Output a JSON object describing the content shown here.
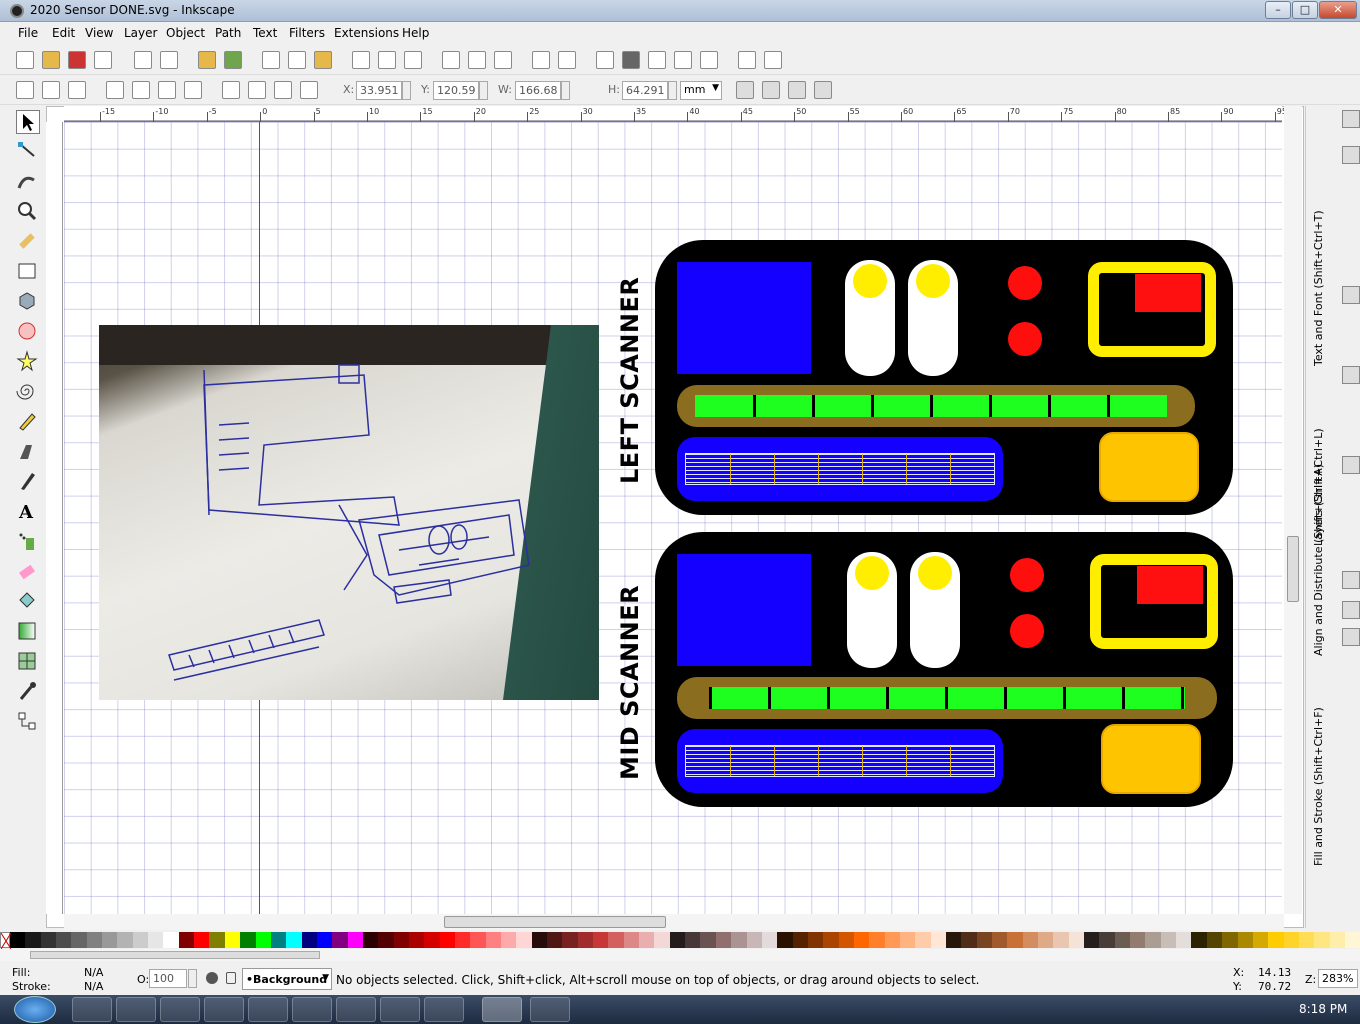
{
  "window": {
    "title": "2020 Sensor DONE.svg - Inkscape",
    "minimize": "–",
    "maximize": "□",
    "close": "✕"
  },
  "menu": [
    "File",
    "Edit",
    "View",
    "Layer",
    "Object",
    "Path",
    "Text",
    "Filters",
    "Extensions",
    "Help"
  ],
  "controls": {
    "x_label": "X:",
    "x_value": "33.951",
    "y_label": "Y:",
    "y_value": "120.590",
    "w_label": "W:",
    "w_value": "166.686",
    "h_label": "H:",
    "h_value": "64.291",
    "unit": "mm"
  },
  "ruler_labels": [
    "-15",
    "-10",
    "-5",
    "0",
    "5",
    "10",
    "15",
    "20",
    "25",
    "30",
    "35",
    "40",
    "45",
    "50",
    "55",
    "60",
    "65",
    "70",
    "75",
    "80",
    "85",
    "90",
    "95",
    "100"
  ],
  "canvas": {
    "scanner_top_label": "LEFT SCANNER",
    "scanner_bottom_label": "MID SCANNER",
    "sketch": {
      "note": "hand sketch photo"
    }
  },
  "docks": {
    "text_font": "Text and Font (Shift+Ctrl+T)",
    "layers": "Layers (Shift+Ctrl+L)",
    "align": "Align and Distribute (Shift+Ctrl+A)",
    "fill_stroke": "Fill and Stroke (Shift+Ctrl+F)"
  },
  "status": {
    "fill_label": "Fill:",
    "fill_value": "N/A",
    "stroke_label": "Stroke:",
    "stroke_value": "N/A",
    "opacity_label": "O:",
    "opacity_value": "100",
    "layer": "•Background",
    "message": "No objects selected. Click, Shift+click, Alt+scroll mouse on top of objects, or drag around objects to select.",
    "x_label": "X:",
    "x_value": "14.13",
    "y_label": "Y:",
    "y_value": "70.72",
    "zoom_label": "Z:",
    "zoom_value": "283%"
  },
  "taskbar": {
    "clock": "8:18 PM"
  },
  "palette": [
    "#000000",
    "#1a1a1a",
    "#333333",
    "#4d4d4d",
    "#666666",
    "#808080",
    "#999999",
    "#b3b3b3",
    "#cccccc",
    "#e6e6e6",
    "#ffffff",
    "#800000",
    "#ff0000",
    "#808000",
    "#ffff00",
    "#008000",
    "#00ff00",
    "#008080",
    "#00ffff",
    "#000080",
    "#0000ff",
    "#800080",
    "#ff00ff",
    "#2b0000",
    "#550000",
    "#800000",
    "#aa0000",
    "#d40000",
    "#ff0000",
    "#ff2a2a",
    "#ff5555",
    "#ff8080",
    "#ffaaaa",
    "#ffd5d5",
    "#280b0b",
    "#501616",
    "#782121",
    "#a02c2c",
    "#c83737",
    "#d35f5f",
    "#de8787",
    "#e9afaf",
    "#f4d7d7",
    "#241c1c",
    "#483737",
    "#6c5353",
    "#916f6f",
    "#ac9393",
    "#c8b7b7",
    "#e3dbdb",
    "#2b1100",
    "#552200",
    "#803300",
    "#aa4400",
    "#d45500",
    "#ff6600",
    "#ff7f2a",
    "#ff9955",
    "#ffb380",
    "#ffccaa",
    "#ffe6d5",
    "#28170b",
    "#502d16",
    "#784421",
    "#a05a2c",
    "#c87137",
    "#d38d5f",
    "#deaa87",
    "#e9c6af",
    "#f4e3d7",
    "#241f1c",
    "#483e37",
    "#6c5d53",
    "#917c6f",
    "#ac9d93",
    "#c8beb7",
    "#e3dedb",
    "#2b2200",
    "#554400",
    "#806600",
    "#aa8800",
    "#d4aa00",
    "#ffcc00",
    "#ffd42a",
    "#ffdd55",
    "#ffe680",
    "#ffeeaa",
    "#fff6d5"
  ]
}
